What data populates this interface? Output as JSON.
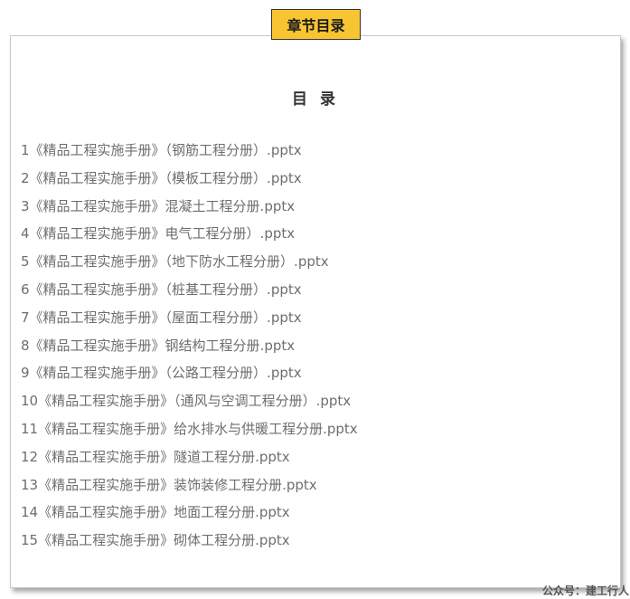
{
  "header": {
    "tag_label": "章节目录"
  },
  "toc": {
    "title": "目 录",
    "items": [
      "1《精品工程实施手册》（钢筋工程分册）.pptx",
      "2《精品工程实施手册》（模板工程分册）.pptx",
      "3《精品工程实施手册》混凝土工程分册.pptx",
      "4《精品工程实施手册》电气工程分册）.pptx",
      "5《精品工程实施手册》（地下防水工程分册）.pptx",
      "6《精品工程实施手册》（桩基工程分册）.pptx",
      "7《精品工程实施手册》（屋面工程分册）.pptx",
      "8《精品工程实施手册》钢结构工程分册.pptx",
      "9《精品工程实施手册》（公路工程分册）.pptx",
      "10《精品工程实施手册》（通风与空调工程分册）.pptx",
      "11《精品工程实施手册》给水排水与供暖工程分册.pptx",
      "12《精品工程实施手册》隧道工程分册.pptx",
      "13《精品工程实施手册》装饰装修工程分册.pptx",
      "14《精品工程实施手册》地面工程分册.pptx",
      "15《精品工程实施手册》砌体工程分册.pptx"
    ]
  },
  "watermark": {
    "text": "公众号：建工行人"
  },
  "colors": {
    "tag_background": "#f7c531",
    "item_text": "#6e6e6e",
    "title_text": "#333333"
  }
}
